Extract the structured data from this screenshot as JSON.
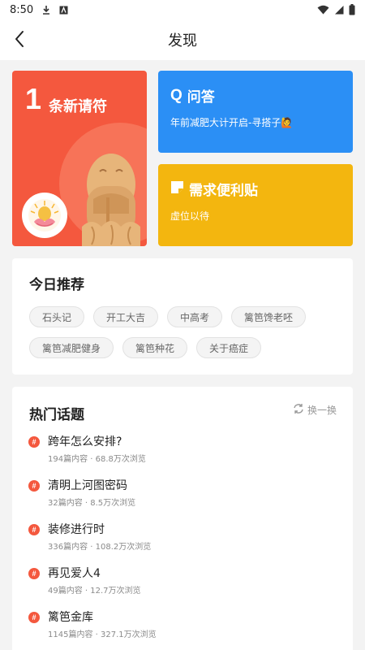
{
  "status_bar": {
    "time": "8:50",
    "icons": [
      "download-icon",
      "a-badge-icon",
      "wifi-icon",
      "signal-icon",
      "battery-icon"
    ]
  },
  "header": {
    "back_icon": "chevron-left-icon",
    "title": "发现"
  },
  "cards": {
    "request": {
      "count": "1",
      "label": "条新请符",
      "color": "#f4583e"
    },
    "qa": {
      "icon": "Q",
      "title": "问答",
      "subtitle": "年前减肥大计开启-寻搭子🙋",
      "color": "#2b8ff5"
    },
    "sticky": {
      "icon": "sticky-note-icon",
      "title": "需求便利贴",
      "subtitle": "虚位以待",
      "color": "#f3b60f"
    }
  },
  "recommend": {
    "title": "今日推荐",
    "tags": [
      "石头记",
      "开工大吉",
      "中高考",
      "篱笆馋老呸",
      "篱笆减肥健身",
      "篱笆种花",
      "关于癌症"
    ]
  },
  "hot_topics": {
    "title": "热门话题",
    "refresh_label": "换一换",
    "items": [
      {
        "title": "跨年怎么安排?",
        "meta": "194篇内容 · 68.8万次浏览"
      },
      {
        "title": "清明上河图密码",
        "meta": "32篇内容 · 8.5万次浏览"
      },
      {
        "title": "装修进行时",
        "meta": "336篇内容 · 108.2万次浏览"
      },
      {
        "title": "再见爱人4",
        "meta": "49篇内容 · 12.7万次浏览"
      },
      {
        "title": "篱笆金库",
        "meta": "1145篇内容 · 327.1万次浏览"
      }
    ]
  },
  "accent_color": "#f4583e"
}
